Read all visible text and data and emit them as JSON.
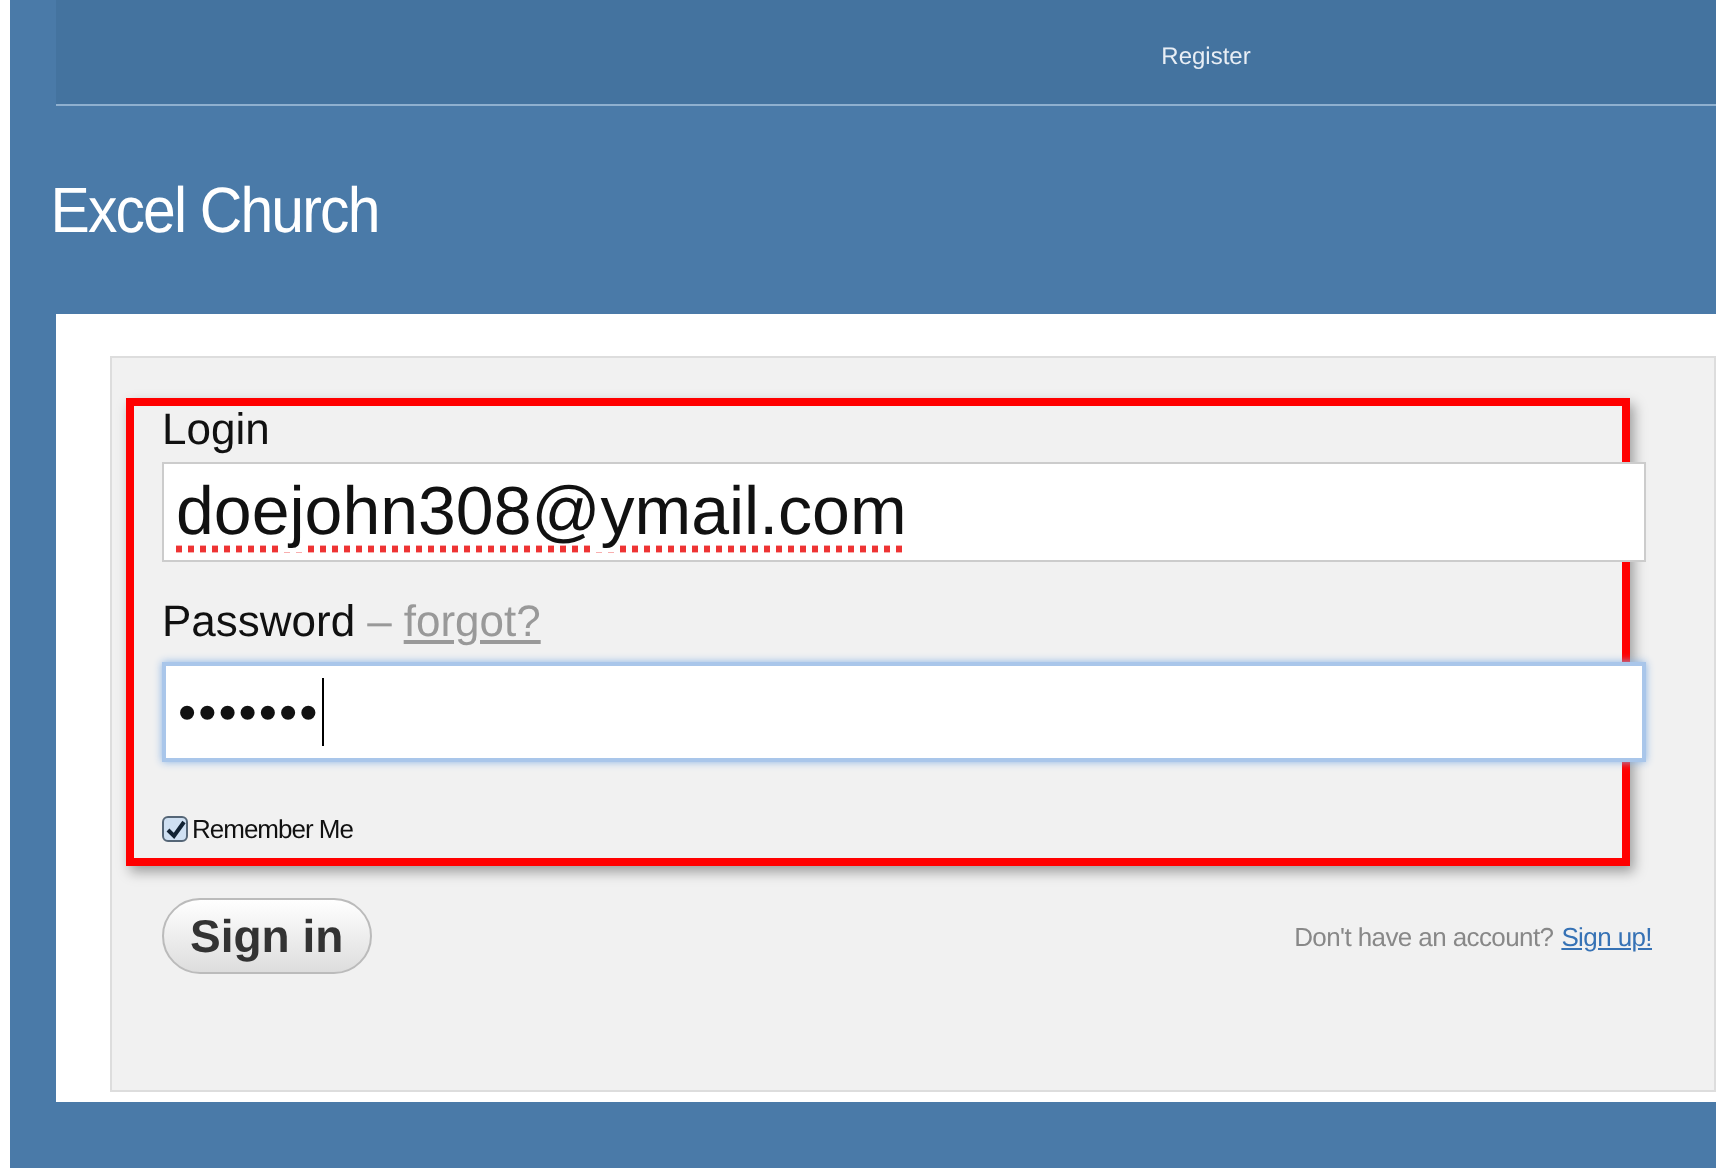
{
  "nav": {
    "link": "Register"
  },
  "site_title": "Excel Church",
  "form": {
    "login_label": "Login",
    "login_value": "doejohn308@ymail.com",
    "password_label": "Password",
    "password_separator": "–",
    "forgot_link": "forgot?",
    "password_value": "•••••••",
    "remember_me": {
      "label": "Remember Me",
      "checked": true
    },
    "sign_in_button": "Sign in",
    "signup_prompt": "Don't have an account?",
    "signup_link": "Sign up!"
  }
}
